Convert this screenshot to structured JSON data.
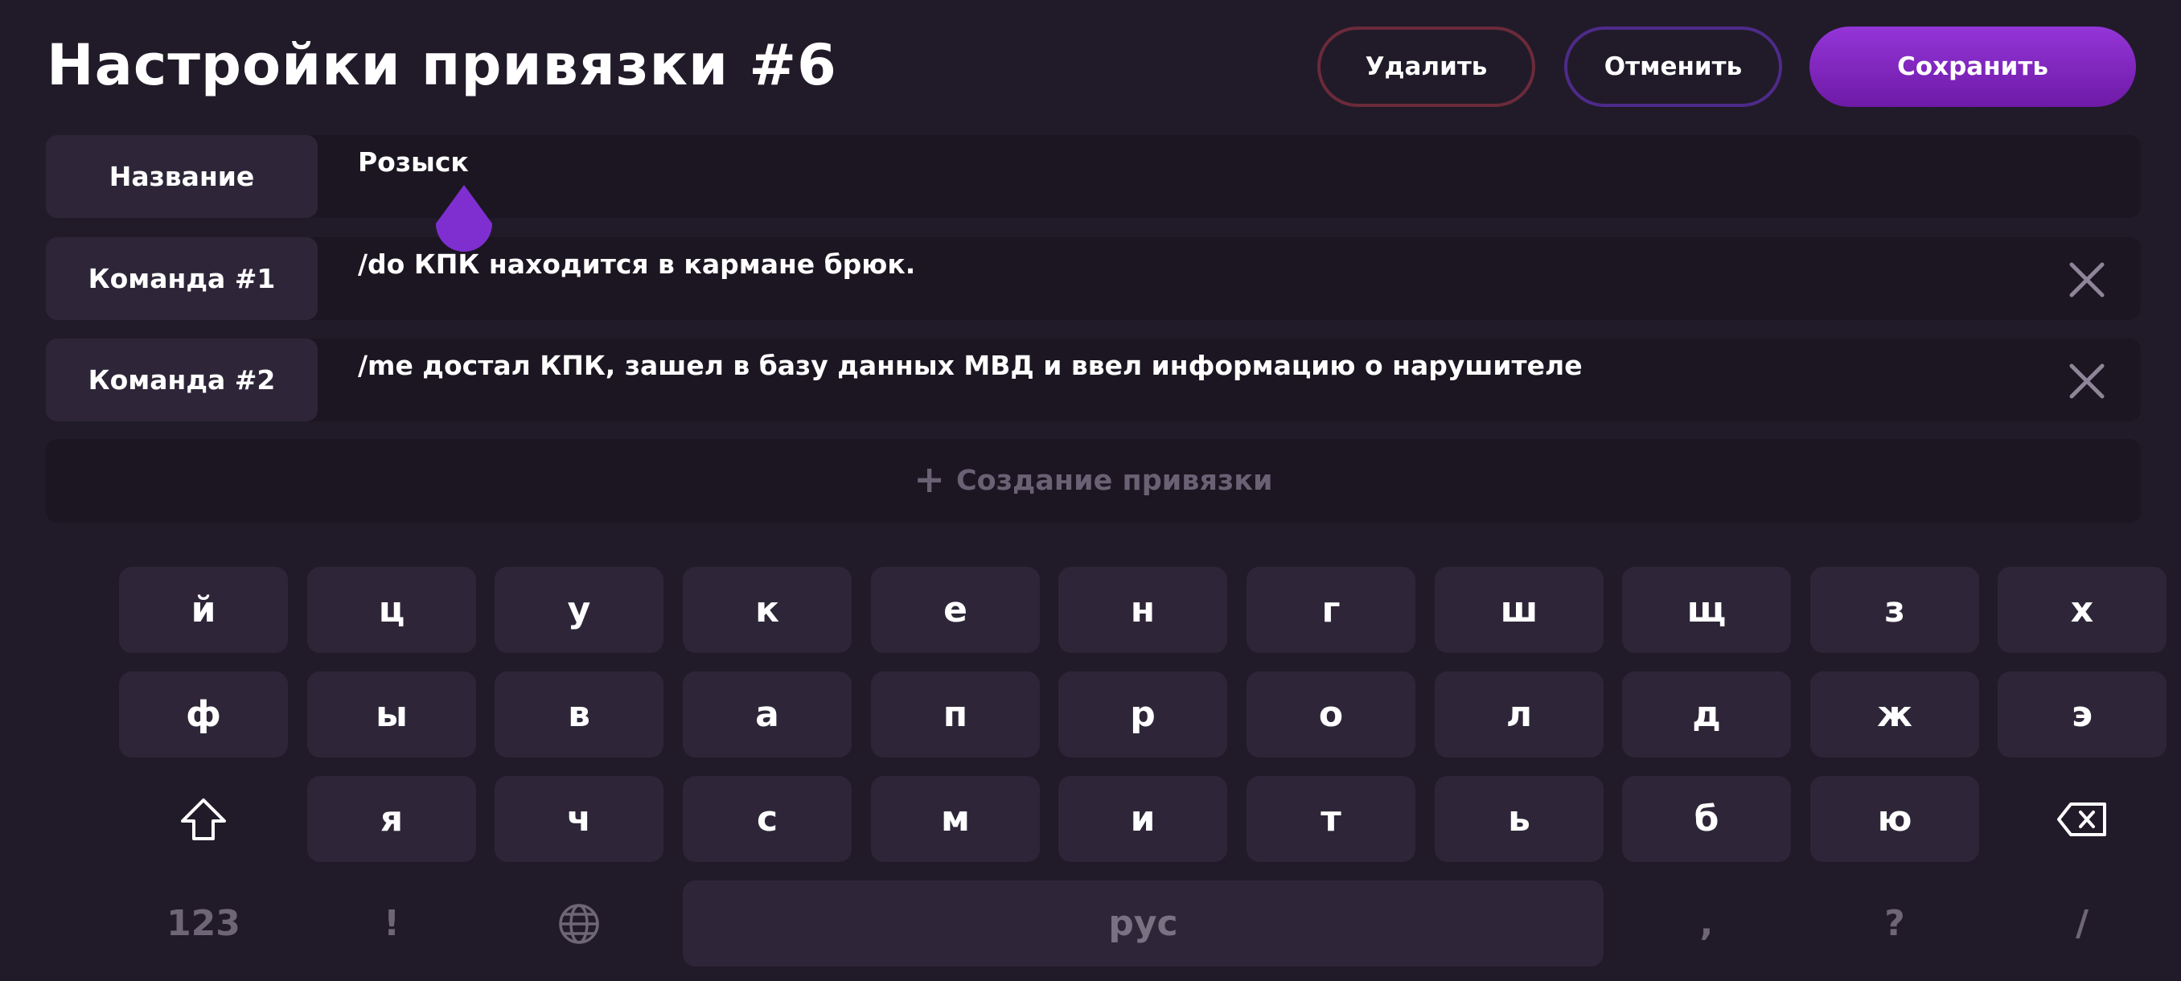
{
  "header": {
    "title": "Настройки привязки #6",
    "buttons": {
      "delete": "Удалить",
      "cancel": "Отменить",
      "save": "Сохранить"
    }
  },
  "fields": [
    {
      "label": "Название",
      "value": "Розыск",
      "clearable": false
    },
    {
      "label": "Команда #1",
      "value": "/do КПК находится в кармане брюк.",
      "clearable": true,
      "clear_icon": "close-icon"
    },
    {
      "label": "Команда #2",
      "value": "/me достал КПК, зашел в базу данных МВД и ввел информацию о нарушителе",
      "clearable": true,
      "clear_icon": "close-icon"
    }
  ],
  "add_binding": {
    "icon": "+",
    "label": "Создание привязки"
  },
  "keyboard": {
    "row1": [
      "й",
      "ц",
      "у",
      "к",
      "е",
      "н",
      "г",
      "ш",
      "щ",
      "з",
      "х"
    ],
    "row2": [
      "ф",
      "ы",
      "в",
      "а",
      "п",
      "р",
      "о",
      "л",
      "д",
      "ж",
      "э"
    ],
    "row3": [
      "я",
      "ч",
      "с",
      "м",
      "и",
      "т",
      "ь",
      "б",
      "ю"
    ],
    "row3_icons": {
      "left": "shift-icon",
      "right": "backspace-icon"
    },
    "row4": {
      "numbers": "123",
      "exclam": "!",
      "globe_icon": "globe-icon",
      "space": "рус",
      "comma": ",",
      "question": "?",
      "slash": "/"
    }
  },
  "colors": {
    "background": "#211b29",
    "accent": "#7f2fd0",
    "save_button": "#8a2ad0",
    "delete_border": "#6b2a3a",
    "cancel_border": "#4e2a8a",
    "key": "#2e2638"
  }
}
